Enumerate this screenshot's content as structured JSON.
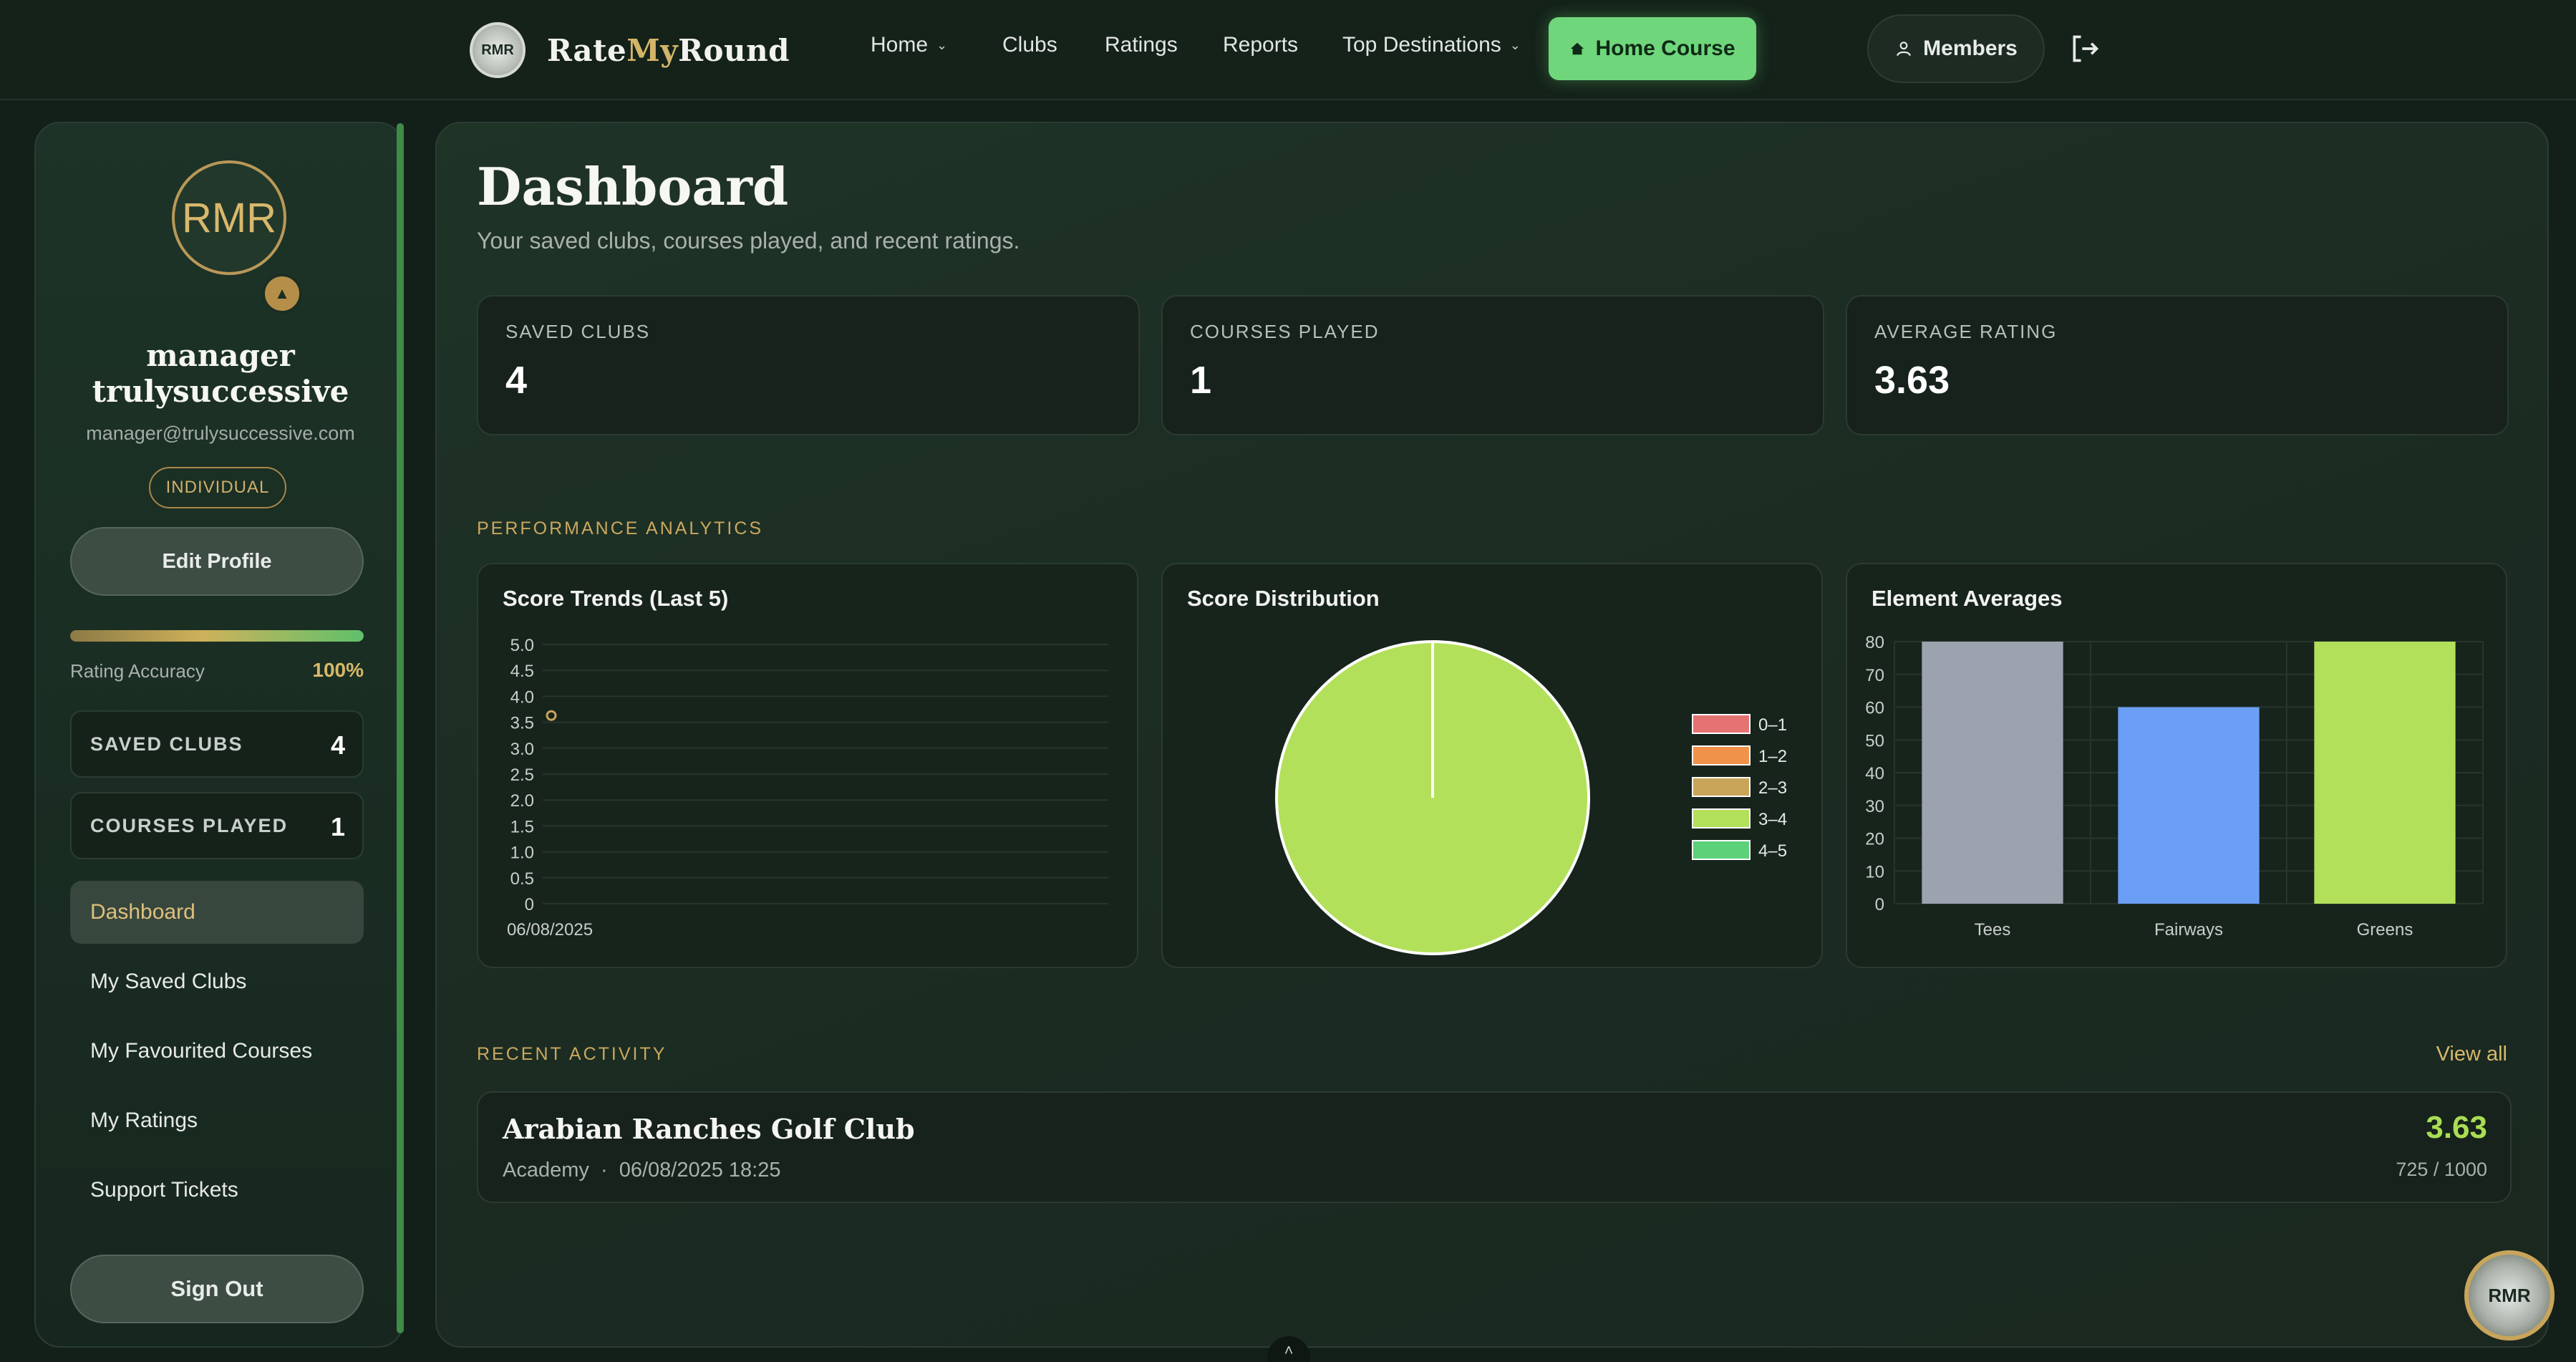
{
  "nav": {
    "brand_prefix": "Rate",
    "brand_my": "My",
    "brand_suffix": "Round",
    "logo_text": "RMR",
    "items": [
      {
        "label": "Home",
        "dropdown": true
      },
      {
        "label": "Clubs"
      },
      {
        "label": "Ratings"
      },
      {
        "label": "Reports"
      },
      {
        "label": "Top Destinations",
        "dropdown": true
      }
    ],
    "home_course": "Home Course",
    "members": "Members"
  },
  "sidebar": {
    "avatar_initials": "RMR",
    "user_name": "manager trulysuccessive",
    "email": "manager@trulysuccessive.com",
    "plan": "INDIVIDUAL",
    "edit_profile": "Edit Profile",
    "rating_accuracy_label": "Rating Accuracy",
    "rating_accuracy_value": "100%",
    "rating_accuracy_fraction": 1.0,
    "stats": [
      {
        "label": "SAVED CLUBS",
        "value": "4"
      },
      {
        "label": "COURSES PLAYED",
        "value": "1"
      }
    ],
    "links": [
      {
        "label": "Dashboard",
        "active": true
      },
      {
        "label": "My Saved Clubs"
      },
      {
        "label": "My Favourited Courses"
      },
      {
        "label": "My Ratings"
      },
      {
        "label": "Support Tickets"
      }
    ],
    "sign_out": "Sign Out"
  },
  "main": {
    "title": "Dashboard",
    "subtitle": "Your saved clubs, courses played, and recent ratings.",
    "kpis": [
      {
        "label": "SAVED CLUBS",
        "value": "4"
      },
      {
        "label": "COURSES PLAYED",
        "value": "1"
      },
      {
        "label": "AVERAGE RATING",
        "value": "3.63"
      }
    ],
    "analytics_heading": "PERFORMANCE ANALYTICS",
    "recent_heading": "RECENT ACTIVITY",
    "view_all": "View all",
    "activity": {
      "club": "Arabian Ranches Golf Club",
      "course": "Academy",
      "separator": "·",
      "datetime": "06/08/2025 18:25",
      "score": "3.63",
      "points": "725 / 1000"
    }
  },
  "colors": {
    "accent_green": "#6fd67c",
    "gold": "#d3b56a",
    "score_green": "#a9dd55"
  },
  "chart_data": [
    {
      "type": "line",
      "title": "Score Trends (Last 5)",
      "x": [
        "06/08/2025"
      ],
      "series": [
        {
          "values": [
            3.63
          ]
        }
      ],
      "ylim": [
        0,
        5
      ],
      "yticks": [
        "5.0",
        "4.5",
        "4.0",
        "3.5",
        "3.0",
        "2.5",
        "2.0",
        "1.5",
        "1.0",
        "0.5",
        "0"
      ],
      "grid": true,
      "color": "#c9a55a"
    },
    {
      "type": "pie",
      "title": "Score Distribution",
      "labels": [
        "0–1",
        "1–2",
        "2–3",
        "3–4",
        "4–5"
      ],
      "values": [
        0,
        0,
        0,
        1,
        0
      ],
      "colors": [
        "#e57373",
        "#f0924a",
        "#c9a55a",
        "#b3e05a",
        "#5dd07a"
      ],
      "legend": "right"
    },
    {
      "type": "bar",
      "title": "Element Averages",
      "categories": [
        "Tees",
        "Fairways",
        "Greens"
      ],
      "values": [
        80,
        60,
        80
      ],
      "colors": [
        "#9ca3af",
        "#6b9ef5",
        "#b3e05a"
      ],
      "ylim": [
        0,
        80
      ],
      "yticks": [
        "80",
        "70",
        "60",
        "50",
        "40",
        "30",
        "20",
        "10",
        "0"
      ],
      "grid": true
    }
  ]
}
